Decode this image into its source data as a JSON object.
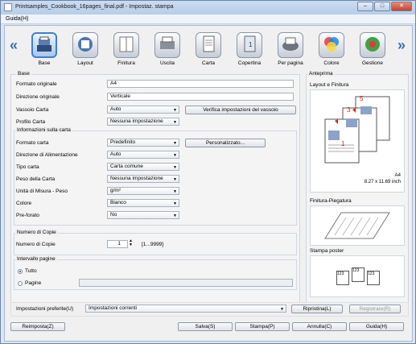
{
  "window": {
    "title": "Printsamples_Cookbook_16pages_final.pdf - Impostaz. stampa",
    "min": "–",
    "max": "□",
    "close": "✕"
  },
  "menu": {
    "guida": "Guida(H)"
  },
  "tabs": [
    {
      "label": "Base",
      "icon": "base-icon"
    },
    {
      "label": "Layout",
      "icon": "layout-icon"
    },
    {
      "label": "Finitura",
      "icon": "finitura-icon"
    },
    {
      "label": "Uscita",
      "icon": "uscita-icon"
    },
    {
      "label": "Carta",
      "icon": "carta-icon"
    },
    {
      "label": "Copertina",
      "icon": "copertina-icon"
    },
    {
      "label": "Per pagina",
      "icon": "per-pagina-icon"
    },
    {
      "label": "Colore",
      "icon": "colore-icon"
    },
    {
      "label": "Gestione",
      "icon": "gestione-icon"
    }
  ],
  "nav": {
    "left": "«",
    "right": "»"
  },
  "base": {
    "legend": "Base",
    "formato_originale": {
      "label": "Formato originale",
      "value": "A4"
    },
    "direzione_originale": {
      "label": "Direzione originale",
      "value": "Verticale"
    },
    "vassoio_carta": {
      "label": "Vassoio Carta",
      "value": "Auto"
    },
    "verifica_button": "Verifica impostazioni del vassoio",
    "profilo_carta": {
      "label": "Profilo Carta",
      "value": "Nessuna impostazione"
    }
  },
  "info": {
    "legend": "Informazioni sulla carta",
    "formato_carta": {
      "label": "Formato carta",
      "value": "Predefinito"
    },
    "personalizzato_button": "Personalizzato...",
    "direzione_alimentazione": {
      "label": "Direzione di Alimentazione",
      "value": "Auto"
    },
    "tipo_carta": {
      "label": "Tipo carta",
      "value": "Carta comune"
    },
    "peso_carta": {
      "label": "Peso della Carta",
      "value": "Nessuna impostazione"
    },
    "unita_misura": {
      "label": "Unità di Misura - Peso",
      "value": "g/m²"
    },
    "colore": {
      "label": "Colore",
      "value": "Bianco"
    },
    "preforato": {
      "label": "Pre-forato",
      "value": "No"
    }
  },
  "copie": {
    "legend": "Numero di Copie",
    "label": "Numero di Copie",
    "value": "1",
    "range": "[1...9999]"
  },
  "intervallo": {
    "legend": "Intervallo pagine",
    "tutto": "Tutto",
    "pagine": "Pagine",
    "pagine_value": ""
  },
  "anteprima": {
    "legend": "Anteprima",
    "layout_title": "Layout e Finitura",
    "page_numbers": [
      "5",
      "3",
      "1"
    ],
    "paper_size": "A4",
    "paper_dims": "8.27 x 11.69 inch",
    "finitura_title": "Finitura-Piegatura",
    "poster_title": "Stampa poster",
    "poster_numbers": [
      "1",
      "2",
      "3",
      "1",
      "2",
      "3",
      "1",
      "2",
      "3"
    ]
  },
  "preferite": {
    "label": "Impostazioni preferite(U)",
    "value": "Impostazioni correnti",
    "ripristina": "Ripristina(L)",
    "registrare": "Registrare(R)"
  },
  "footer": {
    "reimposta": "Reimposta(Z)",
    "salva": "Salva(S)",
    "stampa": "Stampa(P)",
    "annulla": "Annulla(C)",
    "guida": "Guida(H)"
  },
  "colors": {
    "accent": "#3d7fd4",
    "titlebar": "#b7cde8",
    "close": "#c7412c"
  }
}
